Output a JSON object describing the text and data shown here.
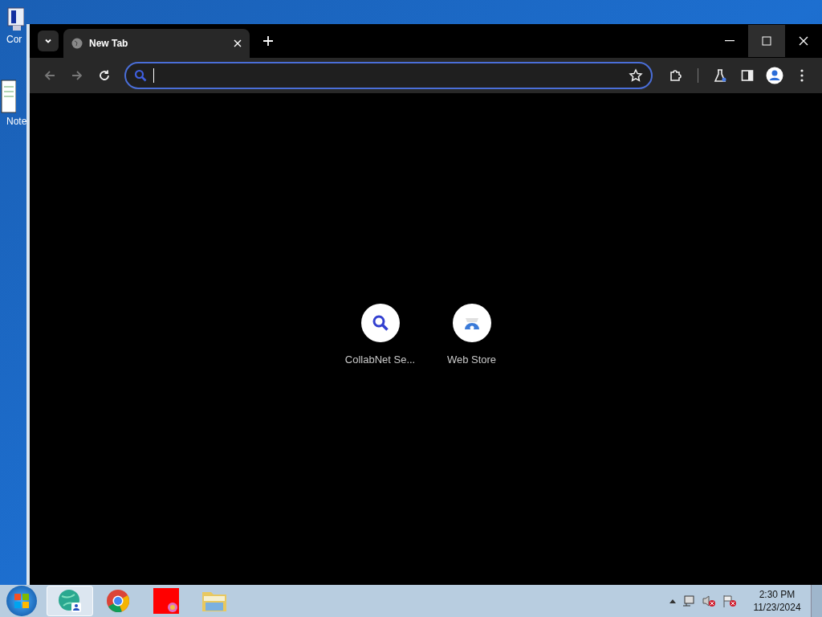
{
  "desktop_icons": [
    {
      "label": "Cor"
    },
    {
      "label": "Note"
    }
  ],
  "browser": {
    "tabs": [
      {
        "title": "New Tab",
        "selected": true
      }
    ],
    "shortcuts": [
      {
        "label": "CollabNet Se...",
        "kind": "search"
      },
      {
        "label": "Web Store",
        "kind": "store"
      }
    ]
  },
  "taskbar": {
    "items": [
      {
        "kind": "app",
        "selected": true
      },
      {
        "kind": "chrome",
        "selected": false
      },
      {
        "kind": "red",
        "selected": false
      },
      {
        "kind": "folder",
        "selected": false
      }
    ],
    "clock": {
      "time": "2:30 PM",
      "date": "11/23/2024"
    }
  }
}
